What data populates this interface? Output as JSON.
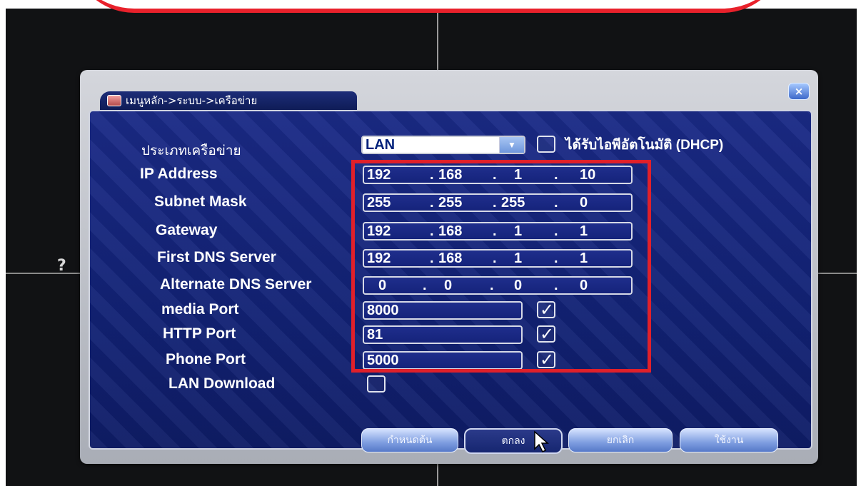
{
  "dialog": {
    "title": "เมนูหลัก->ระบบ->เครือข่าย",
    "close_symbol": "×"
  },
  "network": {
    "type_label": "ประเภทเครือข่าย",
    "type_value": "LAN",
    "dhcp_label": "ได้รับไอพีอัตโนมัติ (DHCP)",
    "dhcp_checked": false,
    "ip_label": "IP Address",
    "ip": [
      "192",
      "168",
      "1",
      "10"
    ],
    "subnet_label": "Subnet Mask",
    "subnet": [
      "255",
      "255",
      "255",
      "0"
    ],
    "gateway_label": "Gateway",
    "gateway": [
      "192",
      "168",
      "1",
      "1"
    ],
    "dns1_label": "First DNS Server",
    "dns1": [
      "192",
      "168",
      "1",
      "1"
    ],
    "dns2_label": "Alternate DNS Server",
    "dns2": [
      "0",
      "0",
      "0",
      "0"
    ],
    "media_port_label": "media Port",
    "media_port": "8000",
    "media_port_checked": true,
    "http_port_label": "HTTP Port",
    "http_port": "81",
    "http_port_checked": true,
    "phone_port_label": "Phone Port",
    "phone_port": "5000",
    "phone_port_checked": true,
    "lan_download_label": "LAN Download",
    "lan_download_checked": false
  },
  "buttons": {
    "advanced": "กำหนดต้น",
    "ok": "ตกลง",
    "cancel": "ยกเลิก",
    "apply": "ใช้งาน"
  },
  "overlay": {
    "help_symbol": "?",
    "check_symbol": "✓",
    "dot": "."
  }
}
